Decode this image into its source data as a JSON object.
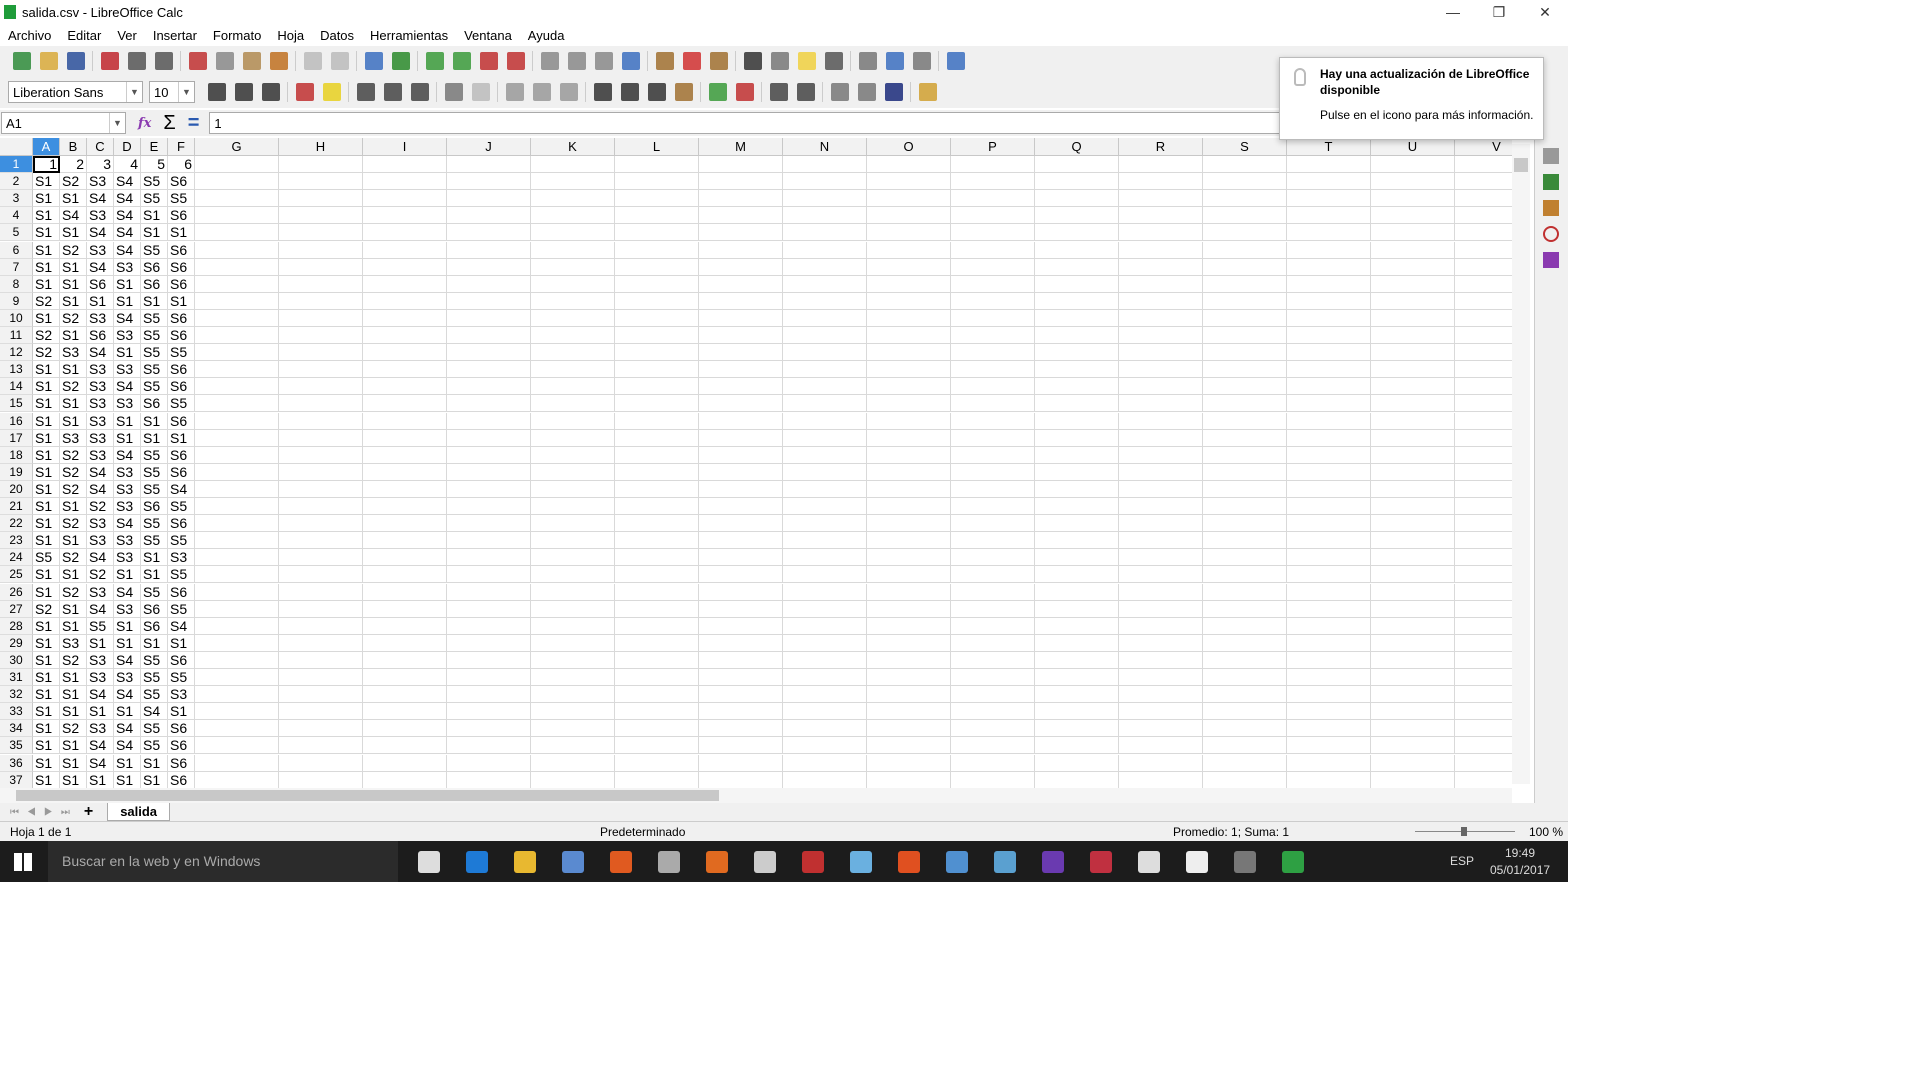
{
  "window": {
    "title": "salida.csv - LibreOffice Calc",
    "minimize": "—",
    "restore": "❐",
    "close": "✕"
  },
  "menu": [
    "Archivo",
    "Editar",
    "Ver",
    "Insertar",
    "Formato",
    "Hoja",
    "Datos",
    "Herramientas",
    "Ventana",
    "Ayuda"
  ],
  "toolbar1": [
    [
      "new-icon",
      "#2e8b3a"
    ],
    [
      "open-icon",
      "#d8a93a"
    ],
    [
      "save-icon",
      "#2a4f9a"
    ],
    [
      "sep",
      ""
    ],
    [
      "export-pdf-icon",
      "#c0262d"
    ],
    [
      "print-icon",
      "#555"
    ],
    [
      "print-preview-icon",
      "#555"
    ],
    [
      "sep",
      ""
    ],
    [
      "cut-icon",
      "#c03030"
    ],
    [
      "copy-icon",
      "#888"
    ],
    [
      "paste-icon",
      "#b08a50"
    ],
    [
      "clone-formatting-icon",
      "#c07020"
    ],
    [
      "sep",
      ""
    ],
    [
      "undo-icon",
      "#bbb"
    ],
    [
      "redo-icon",
      "#bbb"
    ],
    [
      "sep",
      ""
    ],
    [
      "find-replace-icon",
      "#3b6fc0"
    ],
    [
      "spelling-icon",
      "#2a8a2a"
    ],
    [
      "sep",
      ""
    ],
    [
      "insert-row-icon",
      "#3a9a3a"
    ],
    [
      "insert-column-icon",
      "#3a9a3a"
    ],
    [
      "delete-row-icon",
      "#c03030"
    ],
    [
      "delete-column-icon",
      "#c03030"
    ],
    [
      "sep",
      ""
    ],
    [
      "sort-icon",
      "#888"
    ],
    [
      "sort-ascending-icon",
      "#888"
    ],
    [
      "sort-descending-icon",
      "#888"
    ],
    [
      "autofilter-icon",
      "#3b6fc0"
    ],
    [
      "sep",
      ""
    ],
    [
      "insert-image-icon",
      "#a07030"
    ],
    [
      "insert-chart-icon",
      "#d03030"
    ],
    [
      "pivot-table-icon",
      "#a07030"
    ],
    [
      "sep",
      ""
    ],
    [
      "special-character-icon",
      "#333"
    ],
    [
      "hyperlink-icon",
      "#777"
    ],
    [
      "comment-icon",
      "#f0d040"
    ],
    [
      "header-footer-icon",
      "#555"
    ],
    [
      "sep",
      ""
    ],
    [
      "define-print-area-icon",
      "#777"
    ],
    [
      "freeze-rows-icon",
      "#3b6fc0"
    ],
    [
      "split-window-icon",
      "#777"
    ],
    [
      "sep",
      ""
    ],
    [
      "show-draw-functions-icon",
      "#3b6fc0"
    ]
  ],
  "toolbar2": [
    [
      "bold-icon",
      "#333"
    ],
    [
      "italic-icon",
      "#333"
    ],
    [
      "underline-icon",
      "#333"
    ],
    [
      "sep",
      ""
    ],
    [
      "font-color-icon",
      "#c03030"
    ],
    [
      "highlight-color-icon",
      "#e8d020"
    ],
    [
      "sep",
      ""
    ],
    [
      "align-left-icon",
      "#444"
    ],
    [
      "align-center-icon",
      "#444"
    ],
    [
      "align-right-icon",
      "#444"
    ],
    [
      "sep",
      ""
    ],
    [
      "wrap-text-icon",
      "#777"
    ],
    [
      "merge-cells-icon",
      "#bbb"
    ],
    [
      "sep",
      ""
    ],
    [
      "align-top-icon",
      "#999"
    ],
    [
      "align-middle-icon",
      "#999"
    ],
    [
      "align-bottom-icon",
      "#999"
    ],
    [
      "sep",
      ""
    ],
    [
      "currency-icon",
      "#333"
    ],
    [
      "percent-icon",
      "#333"
    ],
    [
      "number-format-icon",
      "#333"
    ],
    [
      "date-format-icon",
      "#a07030"
    ],
    [
      "sep",
      ""
    ],
    [
      "add-decimal-icon",
      "#3a9a3a"
    ],
    [
      "delete-decimal-icon",
      "#c03030"
    ],
    [
      "sep",
      ""
    ],
    [
      "increase-indent-icon",
      "#444"
    ],
    [
      "decrease-indent-icon",
      "#444"
    ],
    [
      "sep",
      ""
    ],
    [
      "borders-icon",
      "#777"
    ],
    [
      "border-style-icon",
      "#777"
    ],
    [
      "border-color-icon",
      "#1a2a7a"
    ],
    [
      "sep",
      ""
    ],
    [
      "conditional-format-icon",
      "#d0a030"
    ]
  ],
  "font": {
    "name": "Liberation Sans",
    "size": "10"
  },
  "formula": {
    "namebox": "A1",
    "value": "1",
    "function_wizard": "fx",
    "sum": "Σ",
    "equals": "="
  },
  "columns": [
    "A",
    "B",
    "C",
    "D",
    "E",
    "F",
    "G",
    "H",
    "I",
    "J",
    "K",
    "L",
    "M",
    "N",
    "O",
    "P",
    "Q",
    "R",
    "S",
    "T",
    "U",
    "V"
  ],
  "rows": [
    [
      "1",
      "2",
      "3",
      "4",
      "5",
      "6"
    ],
    [
      "S1",
      "S2",
      "S3",
      "S4",
      "S5",
      "S6"
    ],
    [
      "S1",
      "S1",
      "S4",
      "S4",
      "S5",
      "S5"
    ],
    [
      "S1",
      "S4",
      "S3",
      "S4",
      "S1",
      "S6"
    ],
    [
      "S1",
      "S1",
      "S4",
      "S4",
      "S1",
      "S1"
    ],
    [
      "S1",
      "S2",
      "S3",
      "S4",
      "S5",
      "S6"
    ],
    [
      "S1",
      "S1",
      "S4",
      "S3",
      "S6",
      "S6"
    ],
    [
      "S1",
      "S1",
      "S6",
      "S1",
      "S6",
      "S6"
    ],
    [
      "S2",
      "S1",
      "S1",
      "S1",
      "S1",
      "S1"
    ],
    [
      "S1",
      "S2",
      "S3",
      "S4",
      "S5",
      "S6"
    ],
    [
      "S2",
      "S1",
      "S6",
      "S3",
      "S5",
      "S6"
    ],
    [
      "S2",
      "S3",
      "S4",
      "S1",
      "S5",
      "S5"
    ],
    [
      "S1",
      "S1",
      "S3",
      "S3",
      "S5",
      "S6"
    ],
    [
      "S1",
      "S2",
      "S3",
      "S4",
      "S5",
      "S6"
    ],
    [
      "S1",
      "S1",
      "S3",
      "S3",
      "S6",
      "S5"
    ],
    [
      "S1",
      "S1",
      "S3",
      "S1",
      "S1",
      "S6"
    ],
    [
      "S1",
      "S3",
      "S3",
      "S1",
      "S1",
      "S1"
    ],
    [
      "S1",
      "S2",
      "S3",
      "S4",
      "S5",
      "S6"
    ],
    [
      "S1",
      "S2",
      "S4",
      "S3",
      "S5",
      "S6"
    ],
    [
      "S1",
      "S2",
      "S4",
      "S3",
      "S5",
      "S4"
    ],
    [
      "S1",
      "S1",
      "S2",
      "S3",
      "S6",
      "S5"
    ],
    [
      "S1",
      "S2",
      "S3",
      "S4",
      "S5",
      "S6"
    ],
    [
      "S1",
      "S1",
      "S3",
      "S3",
      "S5",
      "S5"
    ],
    [
      "S5",
      "S2",
      "S4",
      "S3",
      "S1",
      "S3"
    ],
    [
      "S1",
      "S1",
      "S2",
      "S1",
      "S1",
      "S5"
    ],
    [
      "S1",
      "S2",
      "S3",
      "S4",
      "S5",
      "S6"
    ],
    [
      "S2",
      "S1",
      "S4",
      "S3",
      "S6",
      "S5"
    ],
    [
      "S1",
      "S1",
      "S5",
      "S1",
      "S6",
      "S4"
    ],
    [
      "S1",
      "S3",
      "S1",
      "S1",
      "S1",
      "S1"
    ],
    [
      "S1",
      "S2",
      "S3",
      "S4",
      "S5",
      "S6"
    ],
    [
      "S1",
      "S1",
      "S3",
      "S3",
      "S5",
      "S5"
    ],
    [
      "S1",
      "S1",
      "S4",
      "S4",
      "S5",
      "S3"
    ],
    [
      "S1",
      "S1",
      "S1",
      "S1",
      "S4",
      "S1"
    ],
    [
      "S1",
      "S2",
      "S3",
      "S4",
      "S5",
      "S6"
    ],
    [
      "S1",
      "S1",
      "S4",
      "S4",
      "S5",
      "S6"
    ],
    [
      "S1",
      "S1",
      "S4",
      "S1",
      "S1",
      "S6"
    ],
    [
      "S1",
      "S1",
      "S1",
      "S1",
      "S1",
      "S6"
    ]
  ],
  "sheet_tabs": {
    "add": "+",
    "active": "salida"
  },
  "status": {
    "sheet": "Hoja 1 de 1",
    "style": "Predeterminado",
    "summary": "Promedio: 1; Suma: 1",
    "zoom": "100 %",
    "zoom_level_percent": 100
  },
  "notification": {
    "title": "Hay una actualización de LibreOffice disponible",
    "body": "Pulse en el icono para más información."
  },
  "taskbar": {
    "search_placeholder": "Buscar en la web y en Windows",
    "language": "ESP",
    "time": "19:49",
    "date": "05/01/2017",
    "apps": [
      [
        "task-view-icon",
        "#ddd"
      ],
      [
        "edge-icon",
        "#1e7ad6"
      ],
      [
        "file-explorer-icon",
        "#e8b830"
      ],
      [
        "app-icon",
        "#5a8ad0"
      ],
      [
        "media-player-icon",
        "#e05a20"
      ],
      [
        "steam-icon",
        "#aaa"
      ],
      [
        "firefox-icon",
        "#e06a20"
      ],
      [
        "app-icon",
        "#ccc"
      ],
      [
        "app-icon",
        "#c03030"
      ],
      [
        "app-icon",
        "#6ab0e0"
      ],
      [
        "app-icon",
        "#e05020"
      ],
      [
        "app-icon",
        "#5090d0"
      ],
      [
        "app-icon",
        "#5aa0d0"
      ],
      [
        "app-icon",
        "#6a3ab0"
      ],
      [
        "app-icon",
        "#c03040"
      ],
      [
        "calculator-icon",
        "#ddd"
      ],
      [
        "mail-icon",
        "#eee"
      ],
      [
        "app-icon",
        "#777"
      ],
      [
        "libreoffice-calc-icon",
        "#2ea043"
      ]
    ]
  }
}
